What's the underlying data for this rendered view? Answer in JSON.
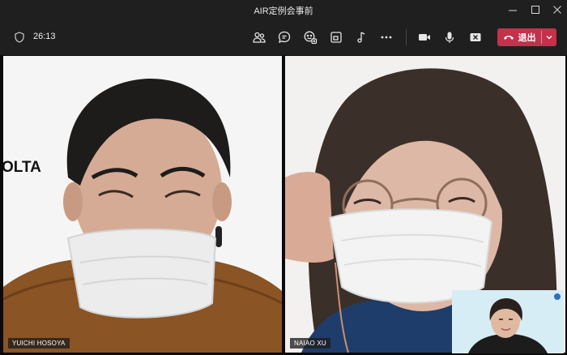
{
  "window": {
    "title": "AIR定例会事前"
  },
  "toolbar": {
    "timer": "26:13",
    "leave_label": "退出"
  },
  "participants": [
    {
      "name": "YUICHI HOSOYA",
      "wall_logo": "OLTA"
    },
    {
      "name": "NAIAO XU"
    }
  ],
  "colors": {
    "active_speaker_border": "#7f85f5",
    "leave_button": "#c4314b"
  }
}
